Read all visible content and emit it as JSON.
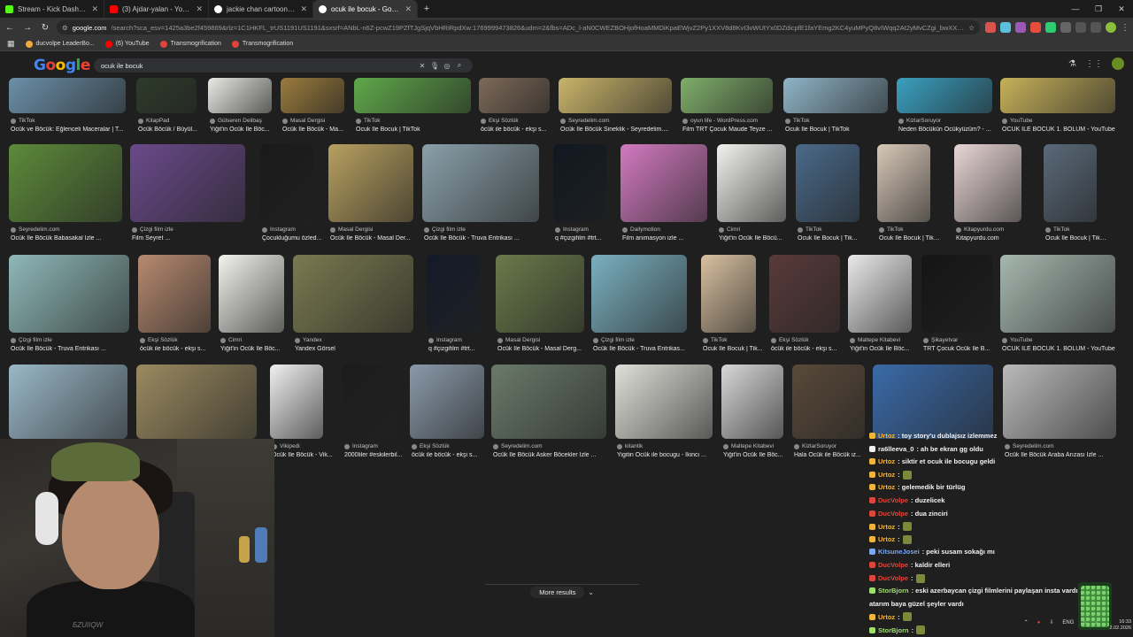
{
  "browser": {
    "tabs": [
      {
        "title": "Stream - Kick Dashboard",
        "color": "#53fc18",
        "active": false
      },
      {
        "title": "(3) Ajdar-yalan - YouTube",
        "color": "#ff0000",
        "active": false
      },
      {
        "title": "jackie chan cartoon - Google S",
        "color": "#ffffff",
        "active": false
      },
      {
        "title": "ocuk ile bocuk - Google Search",
        "color": "#ffffff",
        "active": true
      }
    ],
    "address": {
      "host": "google.com",
      "rest": "/search?sca_esv=1425a3be2f459869&rlz=1C1HKFL_trUS1191US1191&sxsrf=ANbL-n6Z-pcwZ19PZfTJgSjqVbHRiRpdXw:1769999473826&udm=2&fbs=ADc_l-aN0CWEZBOHjofHoaMMDiKpaEWjvZ2Py1XXV8d8KvI3vWUtYx0DZdicpfE1faYEmg2KC4yuMPyQ8vIWqq2At2yMvCZgi_bwXXU0sx2NZz-tCgY1sP..."
    },
    "bookmarks": [
      {
        "label": "ducvolpe LeaderBo...",
        "color": "#f2a93b"
      },
      {
        "label": "(6) YouTube",
        "color": "#ff0000"
      },
      {
        "label": "Transmogrification",
        "color": "#e0453a"
      },
      {
        "label": "Transmogrification",
        "color": "#e0453a"
      }
    ]
  },
  "google": {
    "logo": "Google",
    "query": "ocuk ile bocuk"
  },
  "results": [
    {
      "src": "TikTok",
      "cap": "Öcük ve Böcük: Eğlenceli Maceralar | T...",
      "color": "#6b8fa8"
    },
    {
      "src": "KitapPad",
      "cap": "Öcük Böcük / Büyül...",
      "color": "#2e3b2a"
    },
    {
      "src": "Gülseren Delibaş",
      "cap": "Yiğit'in Öcük İle Böc...",
      "color": "#e9e9e4"
    },
    {
      "src": "Masal Dergisi",
      "cap": "Öcük İle Böcük - Ma...",
      "color": "#9b7b3c"
    },
    {
      "src": "TikTok",
      "cap": "Ocuk Ile Bocuk | TikTok",
      "color": "#5fa84a"
    },
    {
      "src": "Ekşi Sözlük",
      "cap": "öcük ile böcük - ekşi s...",
      "color": "#7d6a58"
    },
    {
      "src": "Seyredelim.com",
      "cap": "Öcük İle Böcük Sineklik - Seyredelim....",
      "color": "#c9b46a"
    },
    {
      "src": "oyun life - WordPress.com",
      "cap": "Film TRT Çocuk Maude Teyze ...",
      "color": "#7fae6a"
    },
    {
      "src": "TikTok",
      "cap": "Ocuk Ile Bocuk | TikTok",
      "color": "#8fb4c7"
    },
    {
      "src": "KizlarSoruyor",
      "cap": "Neden Böcükün Öcükyüzüm? - ...",
      "color": "#3aa0c0"
    },
    {
      "src": "YouTube",
      "cap": "ÖCÜK İLE BÖCÜK 1. BÖLÜM - YouTube",
      "color": "#c6b15a"
    },
    {
      "src": "Seyredelim.com",
      "cap": "Öcük İle Böcük Babasakal İzle ...",
      "color": "#5d8a3a"
    },
    {
      "src": "Çizgi film izle",
      "cap": "Film Seyret ...",
      "color": "#6a4a8a"
    },
    {
      "src": "Instagram",
      "cap": "Çocukluğumu özled...",
      "color": "#1a1a1a"
    },
    {
      "src": "Masal Dergisi",
      "cap": "Öcük İle Böcük - Masal Der...",
      "color": "#b8a060"
    },
    {
      "src": "Çizgi film izle",
      "cap": "Öcük İle Böcük - Truva Entrikası ...",
      "color": "#8aa0aa"
    },
    {
      "src": "Instagram",
      "cap": "q #çizgifilm #trt...",
      "color": "#101820"
    },
    {
      "src": "Dailymotion",
      "cap": "Film animasyon izle ...",
      "color": "#d27ac0"
    },
    {
      "src": "Cimri",
      "cap": "Yiğit'in Öcük İle Böcü...",
      "color": "#f2f2ef"
    },
    {
      "src": "TikTok",
      "cap": "Ocuk Ile Bocuk | Tik...",
      "color": "#4a6a8a"
    },
    {
      "src": "TikTok",
      "cap": "Ocuk Ile Bocuk | TikTok",
      "color": "#d8c8b8"
    },
    {
      "src": "Kitapyurdu.com",
      "cap": "Kitapyurdu.com",
      "color": "#e9d6d6"
    },
    {
      "src": "TikTok",
      "cap": "Ocuk Ile Bocuk | TikTok",
      "color": "#5a6a7a"
    },
    {
      "src": "Çizgi film izle",
      "cap": "Öcük İle Böcük - Truva Entrikası ...",
      "color": "#8fb8b8"
    },
    {
      "src": "Ekşi Sözlük",
      "cap": "öcük ile böcük - ekşi s...",
      "color": "#b88a70"
    },
    {
      "src": "Cimri",
      "cap": "Yiğit'in Öcük İle Böc...",
      "color": "#f2f2ee"
    },
    {
      "src": "Yandex",
      "cap": "Yandex Görsel",
      "color": "#7a7a50"
    },
    {
      "src": "Instagram",
      "cap": "q #çizgifilm #trt...",
      "color": "#141a28"
    },
    {
      "src": "Masal Dergisi",
      "cap": "Öcük İle Böcük - Masal Derg...",
      "color": "#6a7a4a"
    },
    {
      "src": "Çizgi film izle",
      "cap": "Öcük İle Böcük - Truva Entrikas...",
      "color": "#7ab0c0"
    },
    {
      "src": "TikTok",
      "cap": "Ocuk Ile Bocuk | Tik...",
      "color": "#d8c0a0"
    },
    {
      "src": "Ekşi Sözlük",
      "cap": "öcük ile böcük - ekşi s...",
      "color": "#5a3a3a"
    },
    {
      "src": "Maltepe Kitabevi",
      "cap": "Yiğit'in Öcük İle Böc...",
      "color": "#eaeaea"
    },
    {
      "src": "Şikayetvar",
      "cap": "TRT Çocuk Öcük İle B...",
      "color": "#151515"
    },
    {
      "src": "YouTube",
      "cap": "ÖCÜK İLE BÖCÜK 1. BÖLÜM - YouTube",
      "color": "#a6b8b0"
    },
    {
      "src": "",
      "cap": "",
      "color": "#9ab8c8"
    },
    {
      "src": "",
      "cap": "",
      "color": "#9a8a60"
    },
    {
      "src": "Vikipedi",
      "cap": "Öcük İle Böcük - Vik...",
      "color": "#f0f0f0"
    },
    {
      "src": "Instagram",
      "cap": "2000liler #eskilerbil...",
      "color": "#1c1c1c"
    },
    {
      "src": "Ekşi Sözlük",
      "cap": "öcük ile böcük - ekşi s...",
      "color": "#8a9aaa"
    },
    {
      "src": "Seyredelim.com",
      "cap": "Öcük İle Böcük Asker Böcekler İzle ...",
      "color": "#6a7a6a"
    },
    {
      "src": "kitantik",
      "cap": "Yigitin Öcük ile bocugu - İkinci ...",
      "color": "#e0e0da"
    },
    {
      "src": "Maltepe Kitabevi",
      "cap": "Yiğit'in Öcük İle Böc...",
      "color": "#d8d8d8"
    },
    {
      "src": "KizlarSoruyor",
      "cap": "Hala Öcük ile Böcük iz...",
      "color": "#5a4a3a"
    },
    {
      "src": "",
      "cap": "",
      "color": "#3a6aa8"
    },
    {
      "src": "Seyredelim.com",
      "cap": "Öcük İle Böcük Araba Arızası İzle ...",
      "color": "#bababa"
    }
  ],
  "more_results": "More results",
  "chat": [
    {
      "user": "Urtoz",
      "msg": ": toy story'u dublajsız izlemmez",
      "color": "#f2b53b",
      "emote": false
    },
    {
      "user": "ra6lleeva_0",
      "msg": ": ah be ekran gg oldu",
      "color": "#f0f0f0",
      "emote": false
    },
    {
      "user": "Urtoz",
      "msg": ": siktir et ocuk ile bocugu geldi",
      "color": "#f2b53b",
      "emote": false
    },
    {
      "user": "Urtoz",
      "msg": ":",
      "color": "#f2b53b",
      "emote": true
    },
    {
      "user": "Urtoz",
      "msg": ": gelemedik bir türlüg",
      "color": "#f2b53b",
      "emote": false
    },
    {
      "user": "DucVolpe",
      "msg": ": duzelicek",
      "color": "#e0453a",
      "emote": false
    },
    {
      "user": "DucVolpe",
      "msg": ": dua zinciri",
      "color": "#e0453a",
      "emote": false
    },
    {
      "user": "Urtoz",
      "msg": ":",
      "color": "#f2b53b",
      "emote": true
    },
    {
      "user": "Urtoz",
      "msg": ":",
      "color": "#f2b53b",
      "emote": true
    },
    {
      "user": "KitsuneJosei",
      "msg": ": peki susam sokağı mı",
      "color": "#7aa8f0",
      "emote": false
    },
    {
      "user": "DucVolpe",
      "msg": ": kaldir elleri",
      "color": "#e0453a",
      "emote": false
    },
    {
      "user": "DucVolpe",
      "msg": ":",
      "color": "#e0453a",
      "emote": true
    },
    {
      "user": "StorBjorn",
      "msg": ": eski azerbaycan çizgi filmlerini paylaşan insta vardı, onu sana",
      "color": "#9ee06b",
      "emote": false
    },
    {
      "user": "",
      "msg": "atarım baya güzel şeyler vardı",
      "color": "#f0f0f0",
      "emote": false
    },
    {
      "user": "Urtoz",
      "msg": ":",
      "color": "#f2b53b",
      "emote": true
    },
    {
      "user": "StorBjorn",
      "msg": ":",
      "color": "#9ee06b",
      "emote": true
    }
  ],
  "tray": {
    "lang": "ENG",
    "time": "16:33",
    "date": "2.02.2026"
  },
  "webcam_text": "ƂZUIIQW"
}
